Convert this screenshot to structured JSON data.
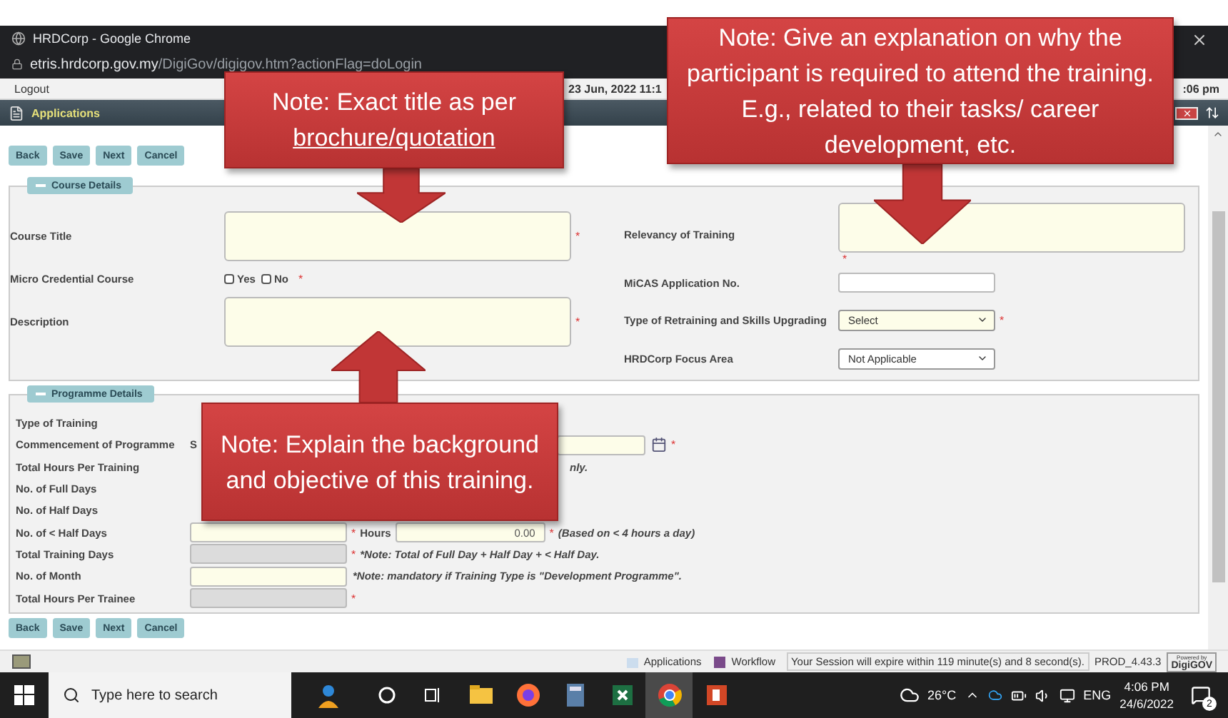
{
  "window": {
    "title": "HRDCorp - Google Chrome",
    "url_domain": "etris.hrdcorp.gov.my",
    "url_path": "/DigiGov/digigov.htm?actionFlag=doLogin"
  },
  "top_bar": {
    "logout": "Logout",
    "date": "23 Jun, 2022 11:1",
    "time": ":06 pm"
  },
  "app_bar": {
    "title": "Applications"
  },
  "actions_top": [
    "Back",
    "Save",
    "Next",
    "Cancel"
  ],
  "course_details": {
    "title": "Course Details",
    "left_fields": [
      {
        "label": "Course Title",
        "kind": "textarea",
        "required_mark": "*"
      },
      {
        "label": "Micro Credential Course",
        "kind": "checkboxes",
        "required_mark": "*",
        "options": [
          {
            "label": "Yes",
            "checked": false
          },
          {
            "label": "No",
            "checked": false
          }
        ]
      },
      {
        "label": "Description",
        "kind": "textarea",
        "required_mark": "*"
      }
    ],
    "right_fields": [
      {
        "label": "Relevancy of Training",
        "kind": "textarea",
        "required_mark": "*"
      },
      {
        "label": "MiCAS Application No.",
        "kind": "input"
      },
      {
        "label": "Type of Retraining and Skills Upgrading",
        "kind": "select",
        "value": "Select",
        "required_mark": "*"
      },
      {
        "label": "HRDCorp Focus Area",
        "kind": "select",
        "value": "Not Applicable"
      }
    ]
  },
  "programme_details": {
    "title": "Programme Details",
    "rows": [
      {
        "label": "Type of Training",
        "kind": "covered"
      },
      {
        "label": "Commencement of Programme",
        "kind": "date",
        "prefix": "S",
        "required_mark": "*"
      },
      {
        "label": "Total Hours Per Training",
        "kind": "covered",
        "note": "nly."
      },
      {
        "label": "No. of Full Days",
        "kind": "covered"
      },
      {
        "label": "No. of Half Days",
        "kind": "covered"
      },
      {
        "label": "No. of < Half Days",
        "kind": "input",
        "required_mark": "*",
        "hours_label": "Hours",
        "hours_value": "0.00",
        "hours_required_mark": "*",
        "note": "(Based on < 4 hours a day)"
      },
      {
        "label": "Total Training Days",
        "kind": "readonly",
        "required_mark": "*",
        "note": "*Note: Total of Full Day + Half Day + < Half Day."
      },
      {
        "label": "No. of Month",
        "kind": "input",
        "note": "*Note: mandatory if Training Type is \"Development Programme\"."
      },
      {
        "label": "Total Hours Per Trainee",
        "kind": "readonly",
        "required_mark": "*"
      }
    ]
  },
  "actions_bottom": [
    "Back",
    "Save",
    "Next",
    "Cancel"
  ],
  "status_bar": {
    "applications": "Applications",
    "workflow": "Workflow",
    "session": "Your Session will expire within 119 minute(s) and 8 second(s).",
    "version": "PROD_4.43.3",
    "logo_small": "Powered by",
    "logo": "DigiGOV"
  },
  "taskbar": {
    "search_placeholder": "Type here to search",
    "apps": [
      {
        "kind": "folder",
        "selected": false
      },
      {
        "kind": "firefox",
        "selected": false
      },
      {
        "kind": "calculator",
        "selected": false
      },
      {
        "kind": "excel",
        "selected": false
      },
      {
        "kind": "chrome",
        "selected": true
      },
      {
        "kind": "powerpoint",
        "selected": false
      }
    ],
    "temperature": "26°C",
    "language": "ENG",
    "time": "4:06 PM",
    "date": "24/6/2022",
    "notifications": "2"
  },
  "callouts": [
    {
      "kind": "down",
      "segments": [
        {
          "text": "Note: Exact title as per ",
          "underline": false
        },
        {
          "text": "brochure/quotation",
          "underline": true
        }
      ]
    },
    {
      "kind": "down",
      "segments": [
        {
          "text": "Note: Give an explanation on why the participant is required to attend the training. E.g., related to their tasks/ career development, etc.",
          "underline": false
        }
      ]
    },
    {
      "kind": "up",
      "segments": [
        {
          "text": "Note: Explain the background and objective of this training.",
          "underline": false
        }
      ]
    }
  ]
}
